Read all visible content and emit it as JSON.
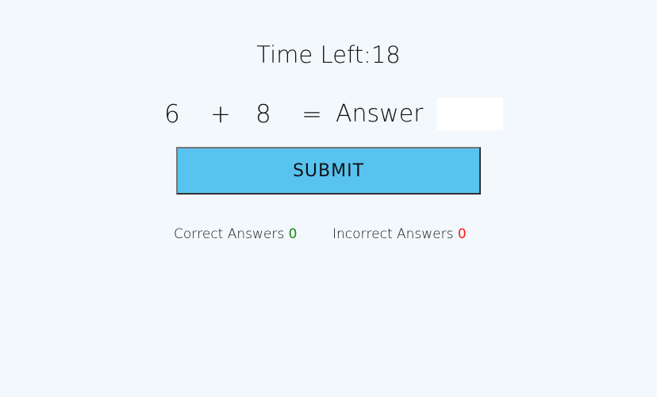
{
  "timer": {
    "label": "Time Left:",
    "value": "18"
  },
  "question": {
    "operand1": "6",
    "operator": "+",
    "operand2": "8",
    "equals": "=",
    "answer_label": "Answer",
    "answer_value": ""
  },
  "submit_label": "SUBMIT",
  "scores": {
    "correct_label": "Correct Answers",
    "correct_value": "0",
    "incorrect_label": "Incorrect Answers",
    "incorrect_value": "0"
  },
  "colors": {
    "correct": "#1a8a1a",
    "incorrect": "#ff1a1a",
    "button": "#59c3f0"
  }
}
